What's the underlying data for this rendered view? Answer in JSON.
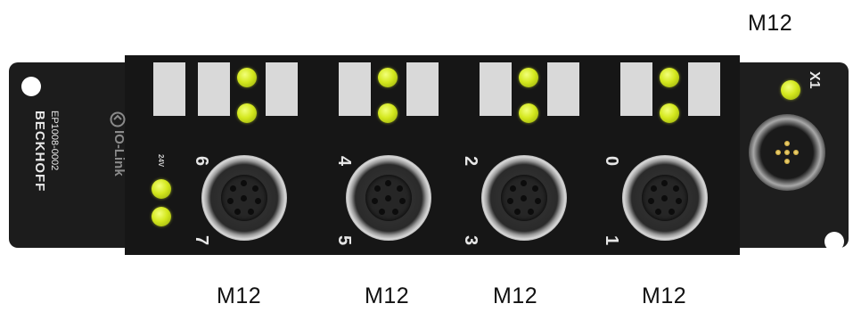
{
  "labels": {
    "m12_top": "M12",
    "m12_ports": [
      "M12",
      "M12",
      "M12",
      "M12"
    ]
  },
  "module": {
    "brand": "BECKHOFF",
    "model": "EP1008-0002",
    "protocol_logo": "IO-Link",
    "supply_label": "24V",
    "supply_leds": 2,
    "x1_label": "X1",
    "ports": [
      {
        "top_number": "6",
        "bottom_number": "7"
      },
      {
        "top_number": "4",
        "bottom_number": "5"
      },
      {
        "top_number": "2",
        "bottom_number": "3"
      },
      {
        "top_number": "0",
        "bottom_number": "1"
      }
    ]
  },
  "colors": {
    "housing": "#161616",
    "led_on": "#d4e81e",
    "label_plate": "#d9d9d9",
    "contact_gold": "#c9a23a"
  }
}
